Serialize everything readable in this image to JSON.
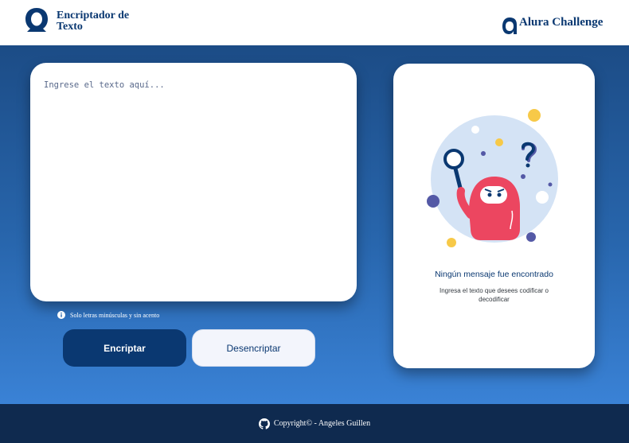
{
  "header": {
    "brand_title": "Encriptador de Texto",
    "logo_icon": "alura-o-logo-icon",
    "challenge_label": "Alura Challenge",
    "challenge_icon": "alura-a-logo-icon"
  },
  "input": {
    "placeholder": "Ingrese el texto aquí...",
    "value": ""
  },
  "hint": {
    "icon": "info-icon",
    "text": "Solo letras minúsculas y sin acento"
  },
  "buttons": {
    "encrypt_label": "Encriptar",
    "decrypt_label": "Desencriptar"
  },
  "output": {
    "illustration": "search-character-illustration",
    "title": "Ningún mensaje fue encontrado",
    "subtitle": "Ingresa el texto que desees codificar o decodificar"
  },
  "footer": {
    "icon": "github-icon",
    "text": "Copyright© - Angeles Guillen"
  },
  "colors": {
    "primary": "#0a3871",
    "background_top": "#1c4c86",
    "background_bottom": "#3a82d6",
    "footer": "#0f2a4f",
    "character": "#ec4660"
  }
}
